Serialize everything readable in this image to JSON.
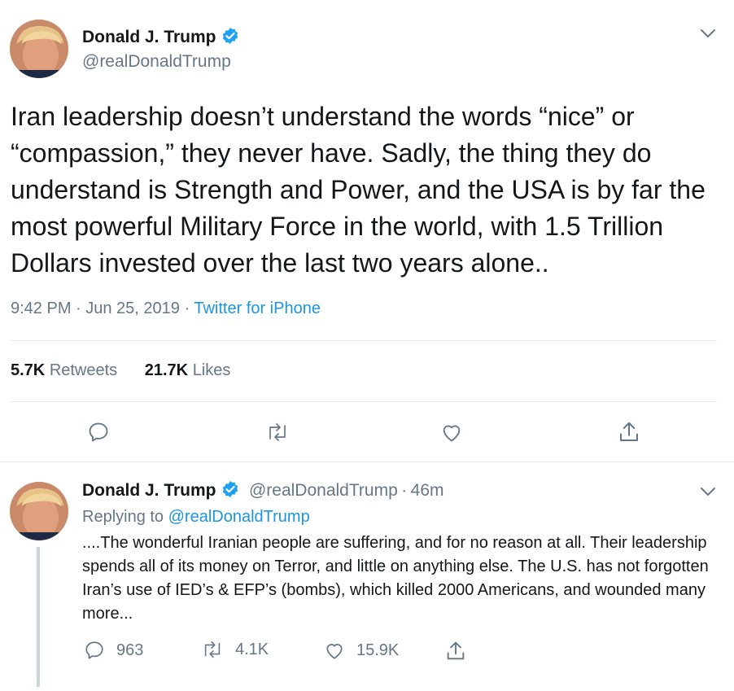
{
  "main_tweet": {
    "author_name": "Donald J. Trump",
    "author_handle": "@realDonaldTrump",
    "text": "Iran leadership doesn’t understand the words “nice” or “compassion,” they never have. Sadly, the thing they do understand is Strength and Power, and the USA is by far the most powerful Military Force in the world, with 1.5 Trillion Dollars invested over the last two years alone..",
    "time": "9:42 PM · Jun 25, 2019 · ",
    "source": "Twitter for iPhone",
    "retweets_count": "5.7K",
    "retweets_label": "Retweets",
    "likes_count": "21.7K",
    "likes_label": "Likes"
  },
  "reply_tweet": {
    "author_name": "Donald J. Trump",
    "author_handle": "@realDonaldTrump",
    "separator": "·",
    "time_ago": "46m",
    "replying_label": "Replying to",
    "replying_to": "@realDonaldTrump",
    "text": "....The wonderful Iranian people are suffering, and for no reason at all. Their leadership spends all of its money on Terror, and little on anything else. The U.S. has not forgotten Iran’s use of IED’s & EFP’s (bombs), which killed 2000 Americans, and wounded many more...",
    "reply_count": "963",
    "retweet_count": "4.1K",
    "like_count": "15.9K"
  },
  "colors": {
    "text": "#14171a",
    "secondary": "#657786",
    "link": "#1b95e0",
    "divider": "#e6ecf0",
    "verified": "#1da1f2"
  },
  "icons": [
    "avatar",
    "verified-badge-icon",
    "chevron-down-icon",
    "reply-icon",
    "retweet-icon",
    "like-icon",
    "share-icon"
  ]
}
